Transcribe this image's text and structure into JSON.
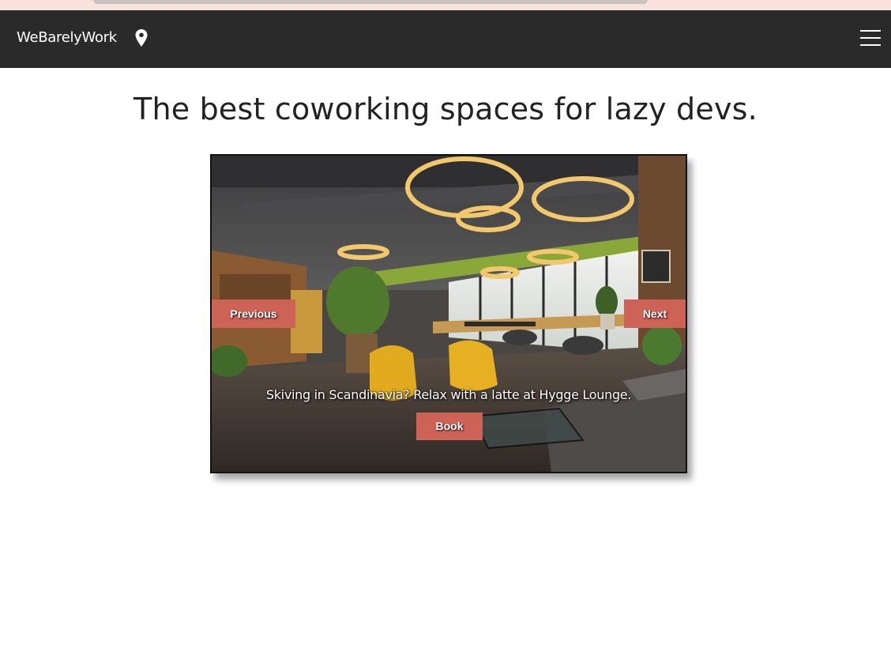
{
  "browser": {},
  "navbar": {
    "brand": "WeBarelyWork",
    "icons": {
      "location": "map-pin-icon",
      "menu": "hamburger-menu-icon"
    }
  },
  "hero": {
    "title": "The best coworking spaces for lazy devs."
  },
  "carousel": {
    "prev_label": "Previous",
    "next_label": "Next",
    "caption": "Skiving in Scandinavia? Relax with a latte at Hygge Lounge.",
    "book_label": "Book"
  },
  "colors": {
    "navbar_bg": "#2a2a2a",
    "accent_button": "#cd6257",
    "browser_strip": "#f8e3dc"
  }
}
